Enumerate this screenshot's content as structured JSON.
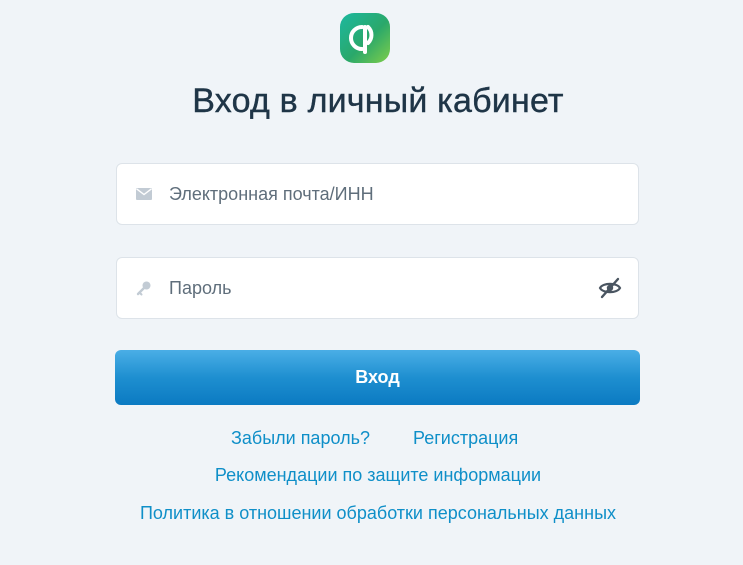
{
  "page": {
    "title": "Вход в личный кабинет"
  },
  "logo": {
    "icon": "brand-logo-icon"
  },
  "form": {
    "email": {
      "placeholder": "Электронная почта/ИНН",
      "value": "",
      "icon": "envelope-icon"
    },
    "password": {
      "placeholder": "Пароль",
      "value": "",
      "icon": "key-icon",
      "toggle_icon": "eye-slash-icon"
    },
    "submit_label": "Вход"
  },
  "links": {
    "forgot_password": "Забыли пароль?",
    "register": "Регистрация",
    "security_recommendations": "Рекомендации по защите информации",
    "privacy_policy": "Политика в отношении обработки персональных данных"
  },
  "colors": {
    "background": "#f0f4f8",
    "title": "#1f3547",
    "link": "#0f8fc8",
    "button": "#1e8fd0"
  }
}
